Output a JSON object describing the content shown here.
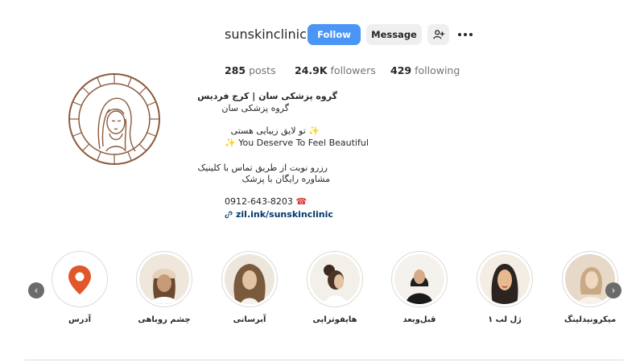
{
  "profile": {
    "username": "sunskinclinic",
    "follow_label": "Follow",
    "message_label": "Message",
    "suggest_icon": "person-add-icon",
    "more_icon": "more-options-icon"
  },
  "stats": {
    "posts_count": "285",
    "posts_label": "posts",
    "followers_count": "24.9K",
    "followers_label": "followers",
    "following_count": "429",
    "following_label": "following"
  },
  "bio": {
    "name": "گروه پزشکی سان | کرج فردیس",
    "category": "گروه پزشکی سان",
    "line_fa": "تو لایق زیبایی هستی",
    "line_en": "You Deserve To Feel Beautiful",
    "booking_1": "رزرو نوبت از طریق تماس با کلینیک",
    "booking_2": "مشاوره رایگان با پزشک",
    "phone": "0912-643-8203",
    "link": "zil.ink/sunskinclinic"
  },
  "highlights": [
    {
      "label": "آدرس",
      "icon": "location-pin-icon"
    },
    {
      "label": "چشم روباهی"
    },
    {
      "label": "آبرسانی"
    },
    {
      "label": "هایفوتراپی"
    },
    {
      "label": "قبل‌وبعد"
    },
    {
      "label": "ژل لب ۱"
    },
    {
      "label": "میکرونیدلینگ"
    }
  ],
  "colors": {
    "follow_button": "#4a95f5",
    "secondary_button": "#efefef",
    "logo_brown": "#8b5a3c",
    "link": "#00376b"
  }
}
